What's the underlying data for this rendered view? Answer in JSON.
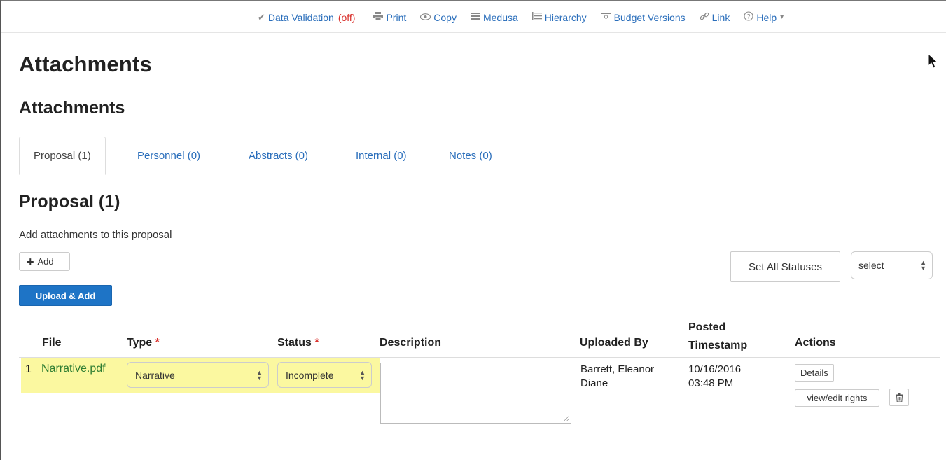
{
  "toolbar": {
    "data_validation": "Data Validation",
    "data_validation_state": "(off)",
    "print": "Print",
    "copy": "Copy",
    "medusa": "Medusa",
    "hierarchy": "Hierarchy",
    "budget_versions": "Budget Versions",
    "link": "Link",
    "help": "Help",
    "help_caret": "▾"
  },
  "page_title": "Attachments",
  "section_title": "Attachments",
  "tabs": [
    {
      "label": "Proposal (1)",
      "active": true
    },
    {
      "label": "Personnel (0)",
      "active": false
    },
    {
      "label": "Abstracts (0)",
      "active": false
    },
    {
      "label": "Internal (0)",
      "active": false
    },
    {
      "label": "Notes (0)",
      "active": false
    }
  ],
  "panel": {
    "title": "Proposal (1)",
    "description": "Add attachments to this proposal",
    "add_label": "Add",
    "upload_add_label": "Upload & Add",
    "set_all_statuses_label": "Set All Statuses",
    "status_select_value": "select"
  },
  "table": {
    "headers": {
      "file": "File",
      "type": "Type",
      "status": "Status",
      "description": "Description",
      "uploaded_by": "Uploaded By",
      "posted_timestamp_line1": "Posted",
      "posted_timestamp_line2": "Timestamp",
      "actions": "Actions",
      "required_marker": "*"
    },
    "rows": [
      {
        "index": "1",
        "file": "Narrative.pdf",
        "type": "Narrative",
        "status": "Incomplete",
        "description": "",
        "uploaded_by_line1": "Barrett, Eleanor",
        "uploaded_by_line2": "Diane",
        "timestamp_date": "10/16/2016",
        "timestamp_time": "03:48 PM",
        "details_label": "Details",
        "rights_label": "view/edit rights"
      }
    ]
  },
  "colors": {
    "link": "#2a6ebb",
    "primary_button": "#1e74c6",
    "highlight": "#fbf8a0",
    "file_link": "#2e7d32",
    "required": "#d9302b"
  }
}
